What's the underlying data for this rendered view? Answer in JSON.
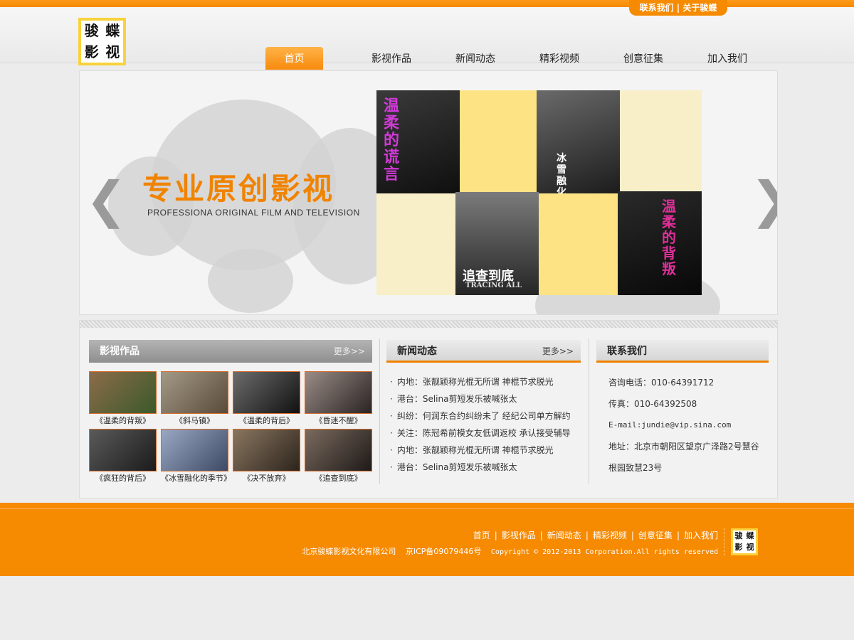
{
  "top_links": {
    "contact": "联系我们",
    "sep": "|",
    "about": "关于骏蝶"
  },
  "logo": {
    "chars": [
      "骏",
      "蝶",
      "影",
      "视"
    ]
  },
  "nav": [
    "首页",
    "影视作品",
    "新闻动态",
    "精彩视频",
    "创意征集",
    "加入我们"
  ],
  "banner": {
    "title": "专业原创影视",
    "subtitle": "PROFESSIONA ORIGINAL FILM AND TELEVISION",
    "prev_arrow": "❮",
    "next_arrow": "❯",
    "posters": {
      "p1": "温柔的谎言",
      "p2": "冰雪融化",
      "p3": "追查到底",
      "p3_en": "TRACING ALL",
      "p4": "温柔的背叛"
    }
  },
  "films": {
    "title": "影视作品",
    "more": "更多>>",
    "items": [
      "《温柔的背叛》",
      "《斜马镇》",
      "《温柔的背后》",
      "《昏迷不醒》",
      "《疯狂的背后》",
      "《冰雪融化的季节》",
      "《决不放弃》",
      "《追查到底》"
    ]
  },
  "news": {
    "title": "新闻动态",
    "more": "更多>>",
    "bullet": "·",
    "items": [
      "内地：张靓颖称光棍无所谓 神棍节求脱光",
      "港台：Selina剪短发乐被喊张太",
      "纠纷：何润东合约纠纷未了 经纪公司单方解约",
      "关注：陈冠希前模女友低调返校 承认接受辅导",
      "内地：张靓颖称光棍无所谓 神棍节求脱光",
      "港台：Selina剪短发乐被喊张太"
    ]
  },
  "contact": {
    "title": "联系我们",
    "phone": "咨询电话：010-64391712",
    "fax": "传真：010-64392508",
    "email": "E-mail:jundie@vip.sina.com",
    "address1": "地址：北京市朝阳区望京广泽路2号慧谷",
    "address2": "根园致慧23号"
  },
  "footer": {
    "nav": [
      "首页",
      "影视作品",
      "新闻动态",
      "精彩视频",
      "创意征集",
      "加入我们"
    ],
    "sep": "|",
    "company": "北京骏蝶影视文化有限公司",
    "icp": "京ICP备09079446号",
    "copyright": "Copyright © 2012-2013 Corporation.All rights reserved"
  },
  "colors": {
    "accent": "#f68a00",
    "nav_active": "#f78a0d",
    "logo_yellow": "#f9d23c"
  }
}
